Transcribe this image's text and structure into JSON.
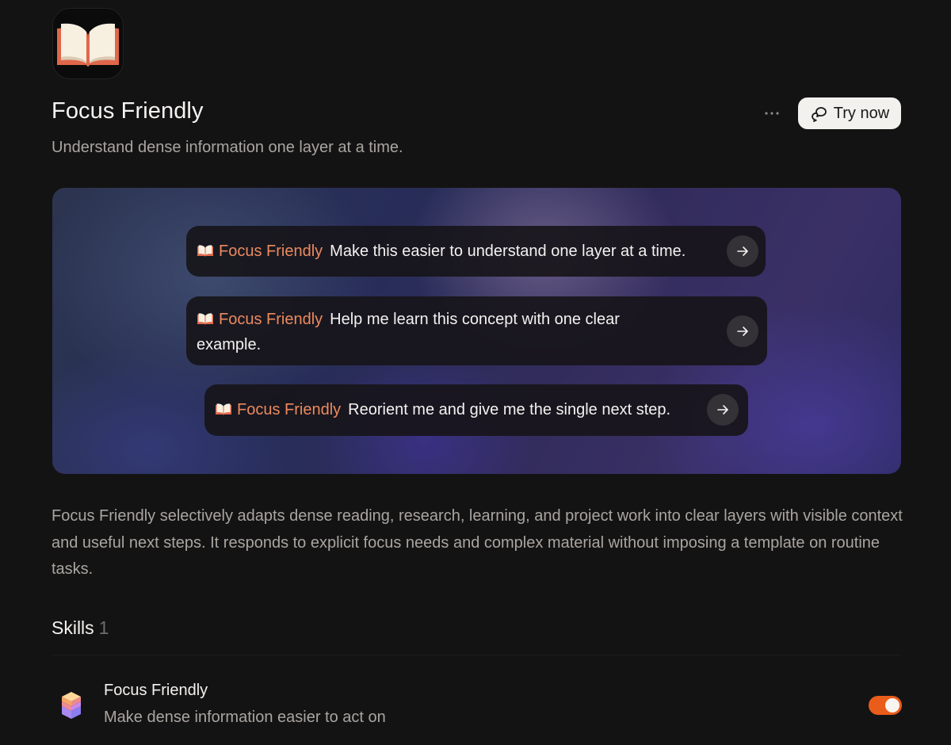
{
  "app": {
    "icon": "open-book-icon",
    "title": "Focus Friendly",
    "subtitle": "Understand dense information one layer at a time."
  },
  "header_actions": {
    "more_icon": "ellipsis-icon",
    "try_icon": "chat-bubbles-icon",
    "try_label": "Try now"
  },
  "hero": {
    "prompts": [
      {
        "tag": "Focus Friendly",
        "text": "Make this easier to understand one layer at a time.",
        "icon": "arrow-right-icon"
      },
      {
        "tag": "Focus Friendly",
        "text": "Help me learn this concept with one clear example.",
        "icon": "arrow-right-icon"
      },
      {
        "tag": "Focus Friendly",
        "text": "Reorient me and give me the single next step.",
        "icon": "arrow-right-icon"
      }
    ]
  },
  "description": "Focus Friendly selectively adapts dense reading, research, learning, and project work into clear layers with visible context and useful next steps. It responds to explicit focus needs and complex material without imposing a template on routine tasks.",
  "skills": {
    "heading": "Skills",
    "count": "1",
    "items": [
      {
        "name": "Focus Friendly",
        "description": "Make dense information easier to act on",
        "icon": "stacked-cubes-icon",
        "enabled": true
      }
    ]
  },
  "colors": {
    "background": "#141313",
    "accent": "#ec8a5e",
    "toggle_on": "#ea5c1a",
    "button_bg": "#f3f1ee"
  }
}
